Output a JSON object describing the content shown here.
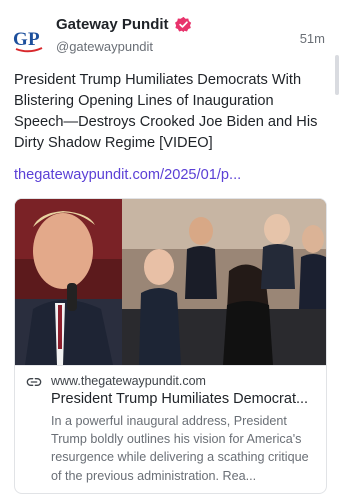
{
  "post": {
    "author": {
      "display_name": "Gateway Pundit",
      "handle": "@gatewaypundit",
      "avatar_text": "GP",
      "verified_icon": "verified-badge-icon"
    },
    "timestamp": "51m",
    "text": "President Trump Humiliates Democrats With Blistering Opening Lines of Inauguration Speech—Destroys Crooked Joe Biden and His Dirty Shadow Regime [VIDEO]",
    "link_text": "thegatewaypundit.com/2025/01/p..."
  },
  "link_card": {
    "domain": "www.thegatewaypundit.com",
    "title": "President Trump Humiliates Democrat...",
    "description": "In a powerful inaugural address, President Trump boldly outlines his vision for America's resurgence while delivering a scathing critique of the previous administration. Rea...",
    "link_icon": "link-icon"
  },
  "colors": {
    "accent": "#5b40d6",
    "verified": "#e8336c",
    "avatar_blue": "#1c4f9c",
    "avatar_red": "#d8282c"
  }
}
